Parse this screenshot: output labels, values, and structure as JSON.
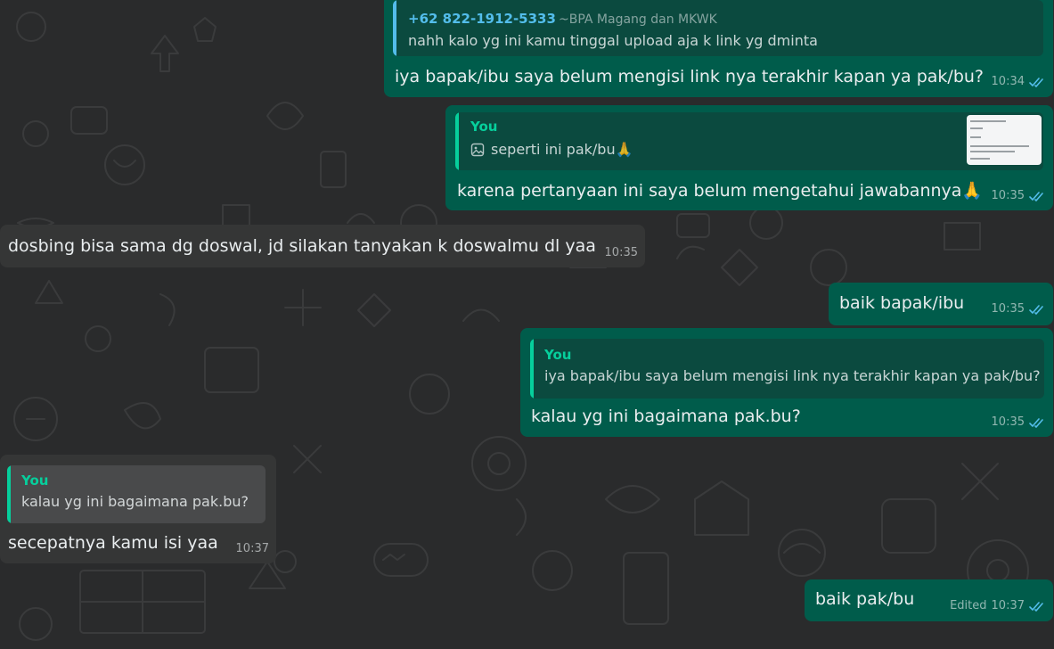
{
  "colors": {
    "outgoing_bubble": "#005c4b",
    "incoming_bubble": "#353636",
    "quote_bar_you": "#06cf9c",
    "quote_bar_contact": "#53bdeb",
    "read_tick": "#53bdeb"
  },
  "messages": [
    {
      "direction": "out",
      "quote": {
        "author": "+62 822-1912-5333",
        "author_name": "~BPA Magang dan MKWK",
        "text": "nahh kalo yg ini kamu tinggal upload aja k link yg dminta"
      },
      "text": "iya bapak/ibu saya belum mengisi link nya terakhir kapan ya pak/bu?",
      "time": "10:34",
      "status_icon": "double-check-read-icon"
    },
    {
      "direction": "out",
      "quote": {
        "author": "You",
        "icon": "image-icon",
        "text": "seperti ini pak/bu🙏",
        "has_thumbnail": true
      },
      "text": "karena pertanyaan ini saya belum mengetahui jawabannya🙏",
      "time": "10:35",
      "status_icon": "double-check-read-icon"
    },
    {
      "direction": "in",
      "text": "dosbing bisa sama dg doswal, jd silakan tanyakan k doswalmu dl yaa",
      "time": "10:35"
    },
    {
      "direction": "out",
      "text": "baik bapak/ibu",
      "time": "10:35",
      "status_icon": "double-check-read-icon"
    },
    {
      "direction": "out",
      "quote": {
        "author": "You",
        "text": "iya bapak/ibu saya belum mengisi link nya terakhir kapan ya pak/bu?"
      },
      "text": "kalau yg ini bagaimana pak.bu?",
      "time": "10:35",
      "status_icon": "double-check-read-icon"
    },
    {
      "direction": "in",
      "quote": {
        "author": "You",
        "text": "kalau yg ini bagaimana pak.bu?"
      },
      "text": "secepatnya kamu isi yaa",
      "time": "10:37"
    },
    {
      "direction": "out",
      "text": "baik pak/bu",
      "edited_label": "Edited",
      "time": "10:37",
      "status_icon": "double-check-read-icon"
    }
  ]
}
